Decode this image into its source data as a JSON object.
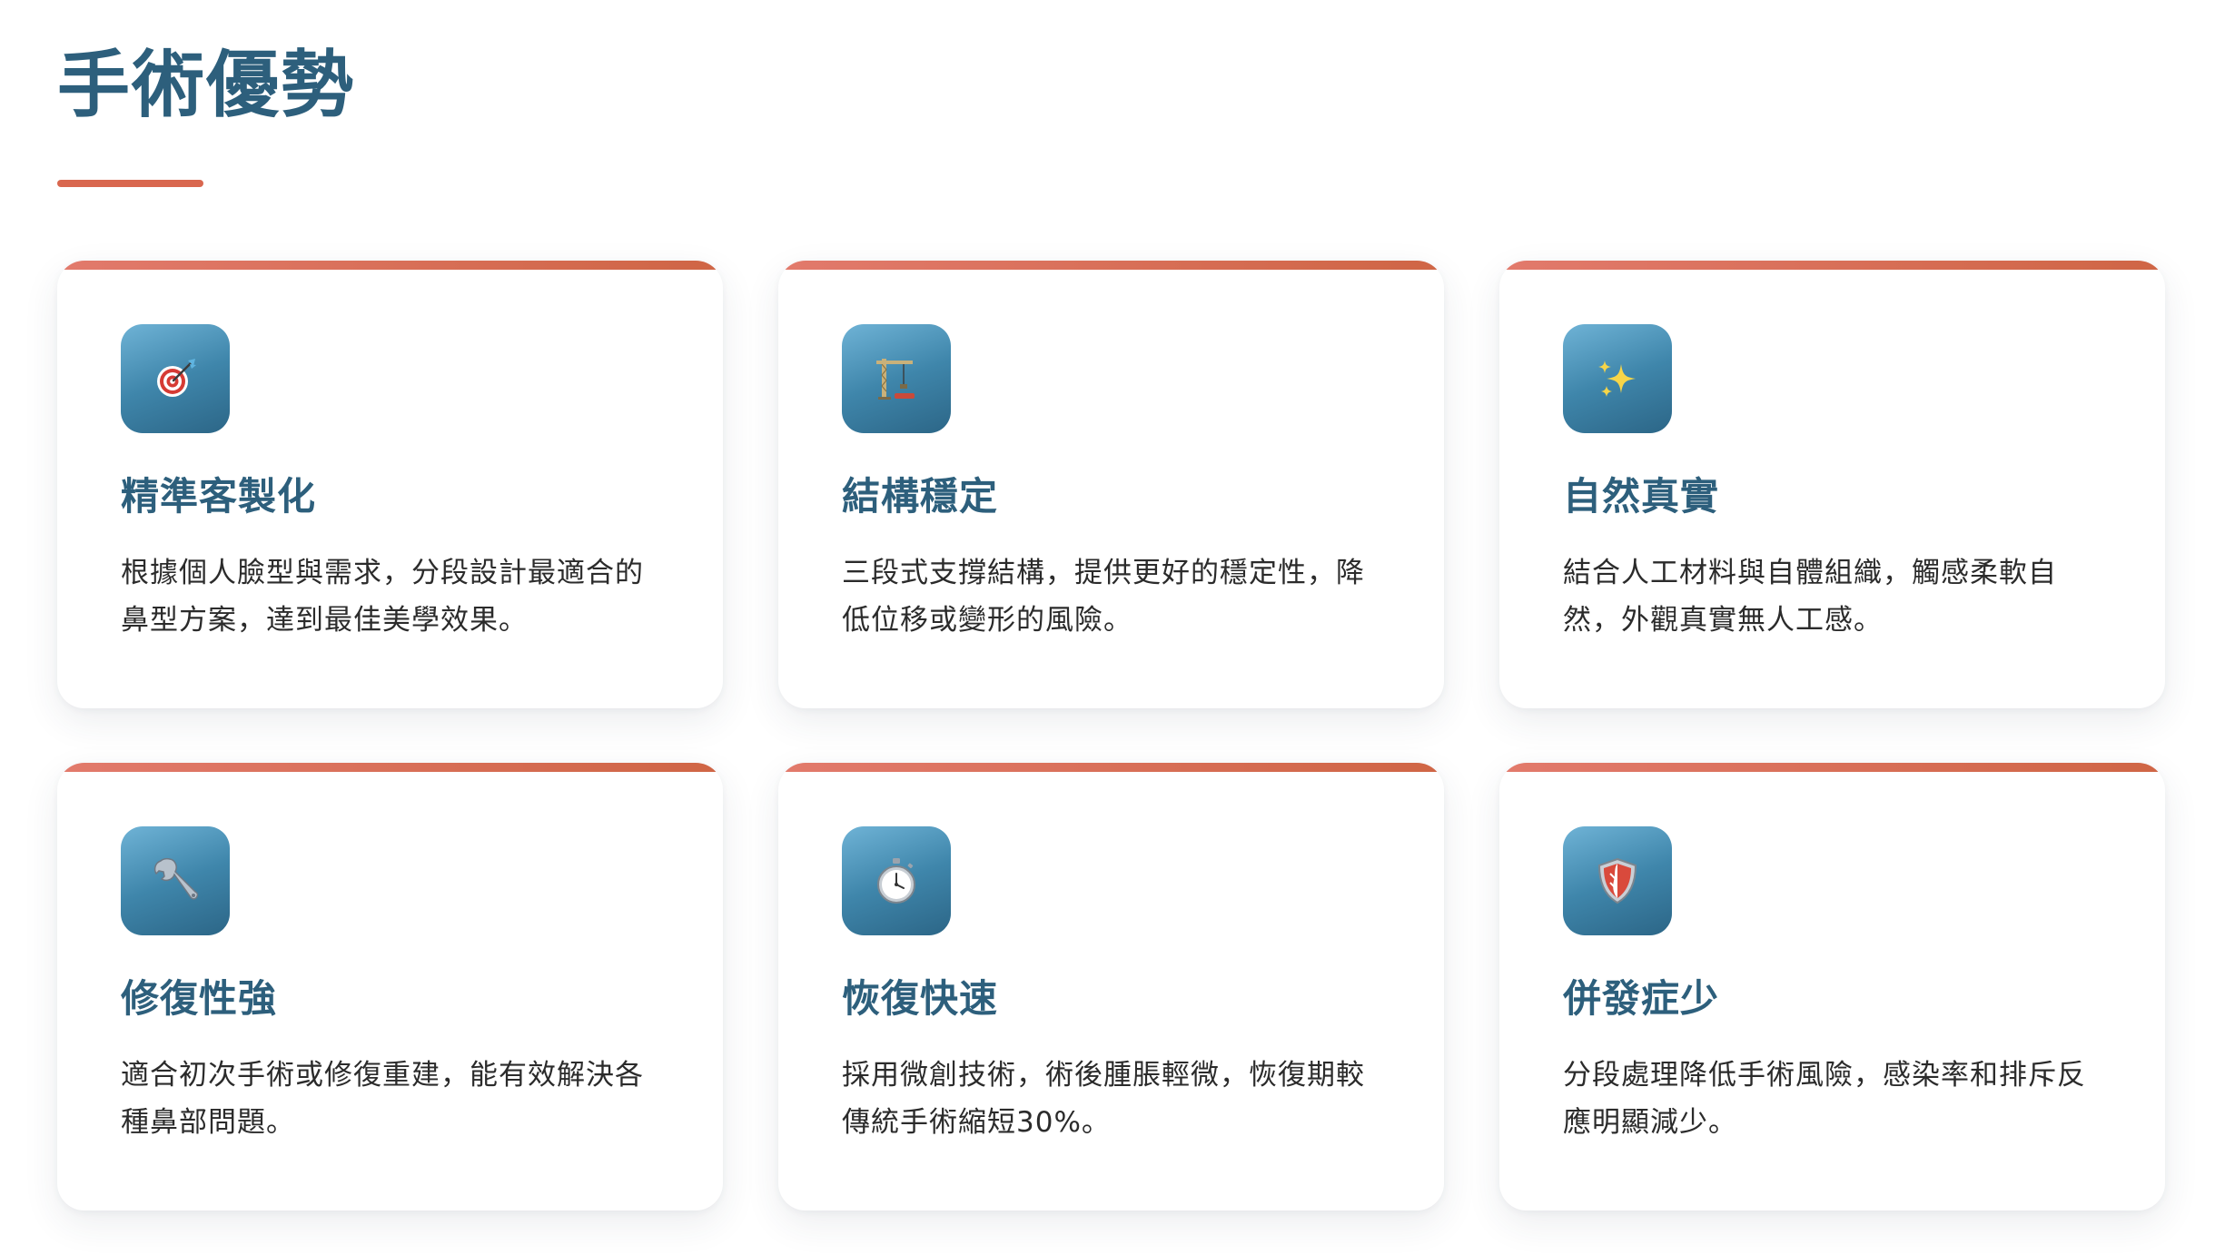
{
  "section": {
    "title": "手術優勢"
  },
  "colors": {
    "title": "#2d5f7c",
    "accent": "#d9674f",
    "icon_bg_start": "#6fb3d6",
    "icon_bg_end": "#2c6687",
    "text": "#2b2b2b"
  },
  "cards": [
    {
      "icon": "target-icon",
      "title": "精準客製化",
      "description": "根據個人臉型與需求，分段設計最適合的鼻型方案，達到最佳美學效果。"
    },
    {
      "icon": "crane-icon",
      "title": "結構穩定",
      "description": "三段式支撐結構，提供更好的穩定性，降低位移或變形的風險。"
    },
    {
      "icon": "sparkles-icon",
      "title": "自然真實",
      "description": "結合人工材料與自體組織，觸感柔軟自然，外觀真實無人工感。"
    },
    {
      "icon": "wrench-icon",
      "title": "修復性強",
      "description": "適合初次手術或修復重建，能有效解決各種鼻部問題。"
    },
    {
      "icon": "stopwatch-icon",
      "title": "恢復快速",
      "description": "採用微創技術，術後腫脹輕微，恢復期較傳統手術縮短30%。"
    },
    {
      "icon": "shield-icon",
      "title": "併發症少",
      "description": "分段處理降低手術風險，感染率和排斥反應明顯減少。"
    }
  ]
}
